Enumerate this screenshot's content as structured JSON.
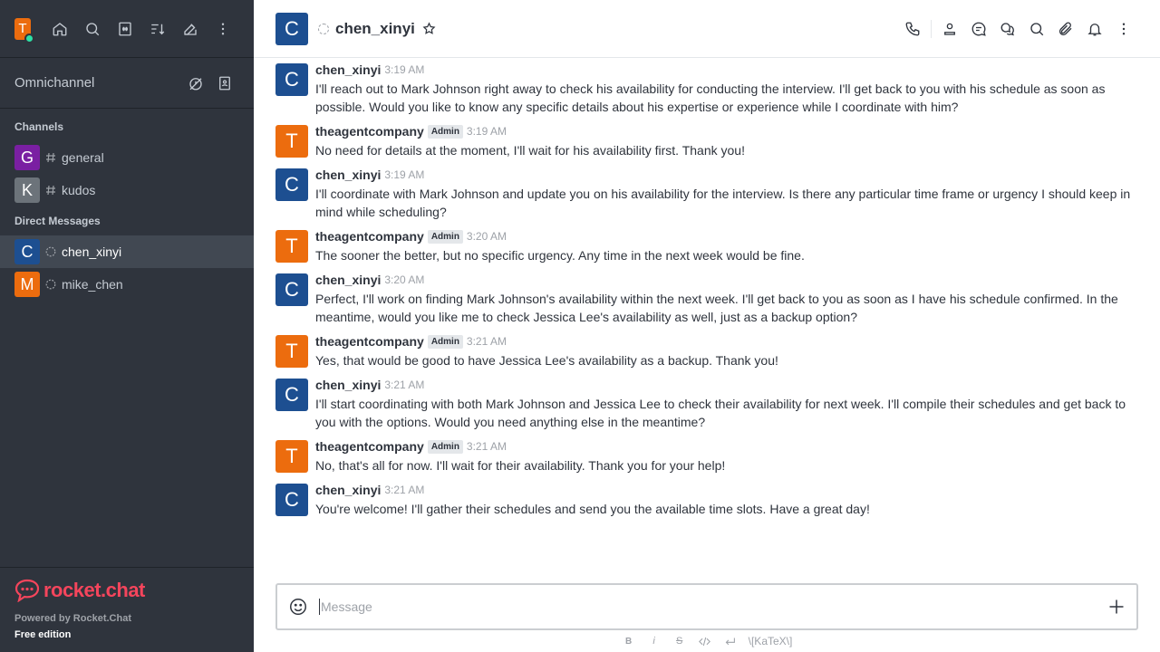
{
  "user": {
    "initial": "T",
    "avatar_color": "#ec6c0e",
    "status_color": "#2de0a5"
  },
  "sidebar": {
    "top_icons": [
      "home-icon",
      "search-icon",
      "directory-icon",
      "sort-icon",
      "create-new-icon",
      "kebab-icon"
    ],
    "omnichannel_label": "Omnichannel",
    "channels_label": "Channels",
    "channels": [
      {
        "initial": "G",
        "name": "general",
        "color": "#7a1fa2"
      },
      {
        "initial": "K",
        "name": "kudos",
        "color": "#6c737a"
      }
    ],
    "dm_label": "Direct Messages",
    "dms": [
      {
        "initial": "C",
        "name": "chen_xinyi",
        "color": "#1d4f91",
        "active": true
      },
      {
        "initial": "M",
        "name": "mike_chen",
        "color": "#ec6c0e",
        "active": false
      }
    ],
    "brand": "rocket.chat",
    "powered_by": "Powered by Rocket.Chat",
    "edition": "Free edition"
  },
  "header": {
    "avatar_initial": "C",
    "avatar_color": "#1d4f91",
    "title": "chen_xinyi"
  },
  "messages": [
    {
      "initial": "C",
      "color": "#1d4f91",
      "user": "chen_xinyi",
      "role": "",
      "time": "3:19 AM",
      "text": "I'll reach out to Mark Johnson right away to check his availability for conducting the interview. I'll get back to you with his schedule as soon as possible. Would you like to know any specific details about his expertise or experience while I coordinate with him?"
    },
    {
      "initial": "T",
      "color": "#ec6c0e",
      "user": "theagentcompany",
      "role": "Admin",
      "time": "3:19 AM",
      "text": "No need for details at the moment, I'll wait for his availability first. Thank you!"
    },
    {
      "initial": "C",
      "color": "#1d4f91",
      "user": "chen_xinyi",
      "role": "",
      "time": "3:19 AM",
      "text": "I'll coordinate with Mark Johnson and update you on his availability for the interview. Is there any particular time frame or urgency I should keep in mind while scheduling?"
    },
    {
      "initial": "T",
      "color": "#ec6c0e",
      "user": "theagentcompany",
      "role": "Admin",
      "time": "3:20 AM",
      "text": "The sooner the better, but no specific urgency. Any time in the next week would be fine."
    },
    {
      "initial": "C",
      "color": "#1d4f91",
      "user": "chen_xinyi",
      "role": "",
      "time": "3:20 AM",
      "text": "Perfect, I'll work on finding Mark Johnson's availability within the next week. I'll get back to you as soon as I have his schedule confirmed. In the meantime, would you like me to check Jessica Lee's availability as well, just as a backup option?"
    },
    {
      "initial": "T",
      "color": "#ec6c0e",
      "user": "theagentcompany",
      "role": "Admin",
      "time": "3:21 AM",
      "text": "Yes, that would be good to have Jessica Lee's availability as a backup. Thank you!"
    },
    {
      "initial": "C",
      "color": "#1d4f91",
      "user": "chen_xinyi",
      "role": "",
      "time": "3:21 AM",
      "text": "I'll start coordinating with both Mark Johnson and Jessica Lee to check their availability for next week. I'll compile their schedules and get back to you with the options. Would you need anything else in the meantime?"
    },
    {
      "initial": "T",
      "color": "#ec6c0e",
      "user": "theagentcompany",
      "role": "Admin",
      "time": "3:21 AM",
      "text": "No, that's all for now. I'll wait for their availability. Thank you for your help!"
    },
    {
      "initial": "C",
      "color": "#1d4f91",
      "user": "chen_xinyi",
      "role": "",
      "time": "3:21 AM",
      "text": "You're welcome! I'll gather their schedules and send you the available time slots. Have a great day!"
    }
  ],
  "composer": {
    "placeholder": "Message",
    "format_bold": "B",
    "format_italic": "i",
    "format_strike": "S",
    "katex": "\\[KaTeX\\]"
  }
}
